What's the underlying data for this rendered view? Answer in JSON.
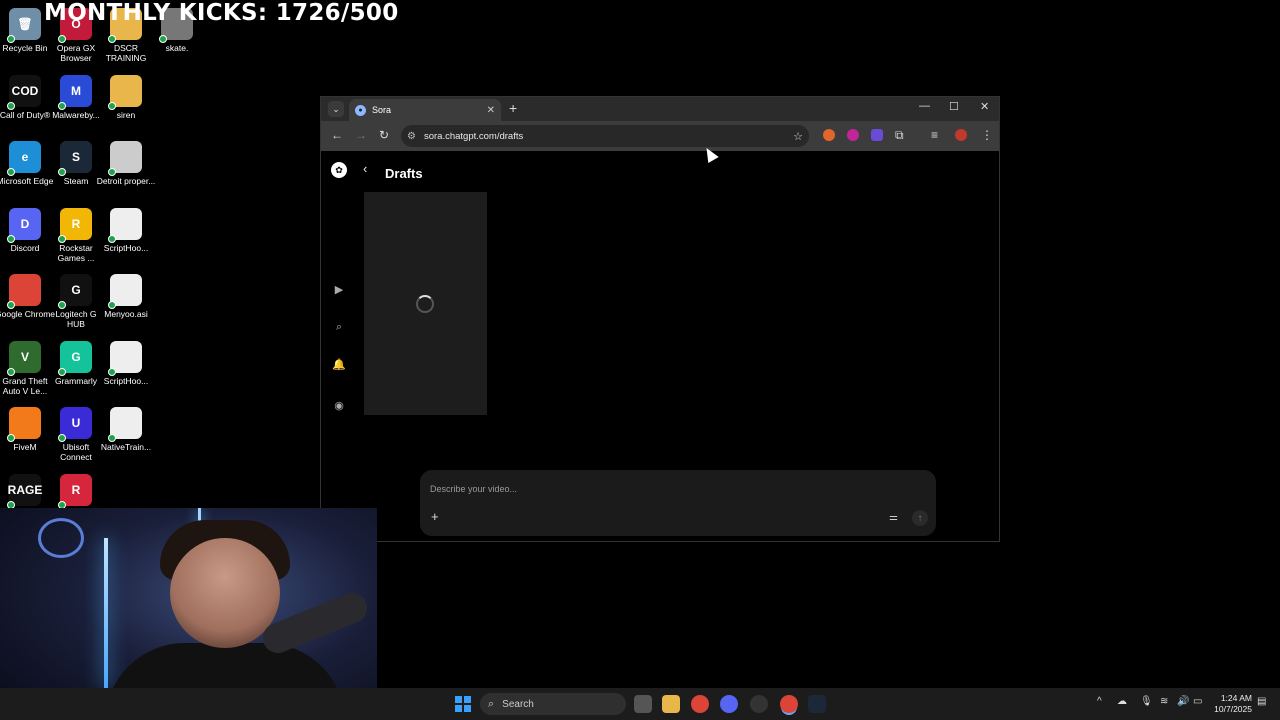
{
  "overlay": {
    "banner": "MONTHLY KICKS: 1726/500"
  },
  "desktop_icons": [
    {
      "label": "Recycle Bin",
      "glyph": "🗑",
      "color": "#6f8fa8"
    },
    {
      "label": "Opera GX Browser",
      "glyph": "O",
      "color": "#c21a3a"
    },
    {
      "label": "DSCR TRAINING",
      "glyph": "",
      "color": "#e8b64a"
    },
    {
      "label": "skate.",
      "glyph": "",
      "color": "#777777"
    },
    {
      "label": "Call of Duty®",
      "glyph": "COD",
      "color": "#111111"
    },
    {
      "label": "Malwareby...",
      "glyph": "M",
      "color": "#2a4bd6"
    },
    {
      "label": "siren",
      "glyph": "",
      "color": "#e8b64a"
    },
    {
      "label": "Microsoft Edge",
      "glyph": "e",
      "color": "#1e8fd6"
    },
    {
      "label": "Steam",
      "glyph": "S",
      "color": "#1b2838"
    },
    {
      "label": "Detroit proper...",
      "glyph": "",
      "color": "#cccccc"
    },
    {
      "label": "Discord",
      "glyph": "D",
      "color": "#5865f2"
    },
    {
      "label": "Rockstar Games ...",
      "glyph": "R",
      "color": "#f2b705"
    },
    {
      "label": "ScriptHoo...",
      "glyph": "",
      "color": "#eeeeee"
    },
    {
      "label": "Google Chrome",
      "glyph": "",
      "color": "#db4437"
    },
    {
      "label": "Logitech G HUB",
      "glyph": "G",
      "color": "#111111"
    },
    {
      "label": "Menyoo.asi",
      "glyph": "",
      "color": "#eeeeee"
    },
    {
      "label": "Grand Theft Auto V Le...",
      "glyph": "V",
      "color": "#2f6b2f"
    },
    {
      "label": "Grammarly",
      "glyph": "G",
      "color": "#15c39a"
    },
    {
      "label": "ScriptHoo...",
      "glyph": "",
      "color": "#eeeeee"
    },
    {
      "label": "FiveM",
      "glyph": "",
      "color": "#f27a1a"
    },
    {
      "label": "Ubisoft Connect",
      "glyph": "U",
      "color": "#3a2bd6"
    },
    {
      "label": "NativeTrain...",
      "glyph": "",
      "color": "#eeeeee"
    },
    {
      "label": "RAGE",
      "glyph": "RAGE",
      "color": "#111111"
    },
    {
      "label": "",
      "glyph": "R",
      "color": "#d6263b"
    }
  ],
  "browser": {
    "tab_title": "Sora",
    "url": "sora.chatgpt.com/drafts",
    "page_title": "Drafts",
    "composer_placeholder": "Describe your video..."
  },
  "taskbar": {
    "search_label": "Search",
    "time": "1:24 AM",
    "date": "10/7/2025"
  }
}
